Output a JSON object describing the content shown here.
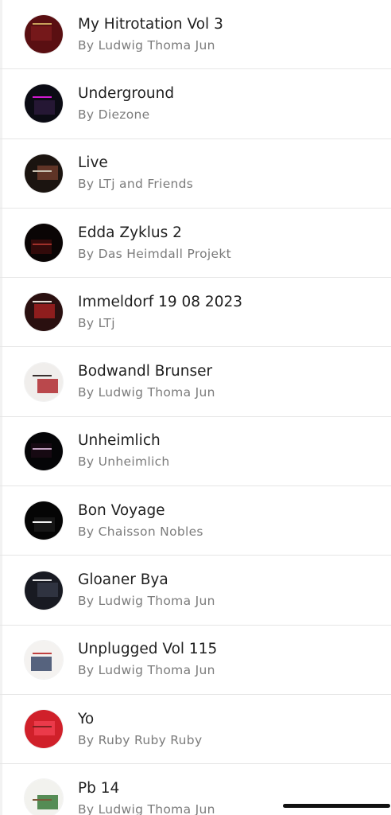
{
  "playlists": [
    {
      "title": "My Hitrotation Vol 3",
      "subtitle": "By Ludwig Thoma Jun",
      "cover_colors": [
        "#5a0f12",
        "#7a1a1c",
        "#c9a15b"
      ]
    },
    {
      "title": "Underground",
      "subtitle": "By Diezone",
      "cover_colors": [
        "#0b0b14",
        "#2a1a3a",
        "#d01ad0"
      ]
    },
    {
      "title": "Live",
      "subtitle": "By LTj and Friends",
      "cover_colors": [
        "#1b1410",
        "#6b3a2a",
        "#c8c0b0"
      ]
    },
    {
      "title": "Edda Zyklus 2",
      "subtitle": "By Das Heimdall Projekt",
      "cover_colors": [
        "#0a0505",
        "#3a0c0c",
        "#a0302a"
      ]
    },
    {
      "title": "Immeldorf 19 08 2023",
      "subtitle": "By LTj",
      "cover_colors": [
        "#2a1010",
        "#a02020",
        "#e8e0d8"
      ]
    },
    {
      "title": "Bodwandl Brunser",
      "subtitle": "By Ludwig Thoma Jun",
      "cover_colors": [
        "#f0eeec",
        "#b02a30",
        "#3a3030"
      ]
    },
    {
      "title": "Unheimlich",
      "subtitle": "By Unheimlich",
      "cover_colors": [
        "#050507",
        "#1a0a14",
        "#c0a0c0"
      ]
    },
    {
      "title": "Bon Voyage",
      "subtitle": "By Chaisson Nobles",
      "cover_colors": [
        "#050505",
        "#1a1a1a",
        "#f2f2f2"
      ]
    },
    {
      "title": "Gloaner Bya",
      "subtitle": "By Ludwig Thoma Jun",
      "cover_colors": [
        "#181a22",
        "#343845",
        "#e0e0e0"
      ]
    },
    {
      "title": "Unplugged Vol 115",
      "subtitle": "By Ludwig Thoma Jun",
      "cover_colors": [
        "#f4f2f0",
        "#3a4a6a",
        "#c04040"
      ]
    },
    {
      "title": "Yo",
      "subtitle": "By Ruby Ruby Ruby",
      "cover_colors": [
        "#d0202a",
        "#f04050",
        "#802020"
      ]
    },
    {
      "title": "Pb 14",
      "subtitle": "By Ludwig Thoma Jun",
      "cover_colors": [
        "#f2f2ee",
        "#3a7a3a",
        "#7a5a3a"
      ]
    }
  ]
}
